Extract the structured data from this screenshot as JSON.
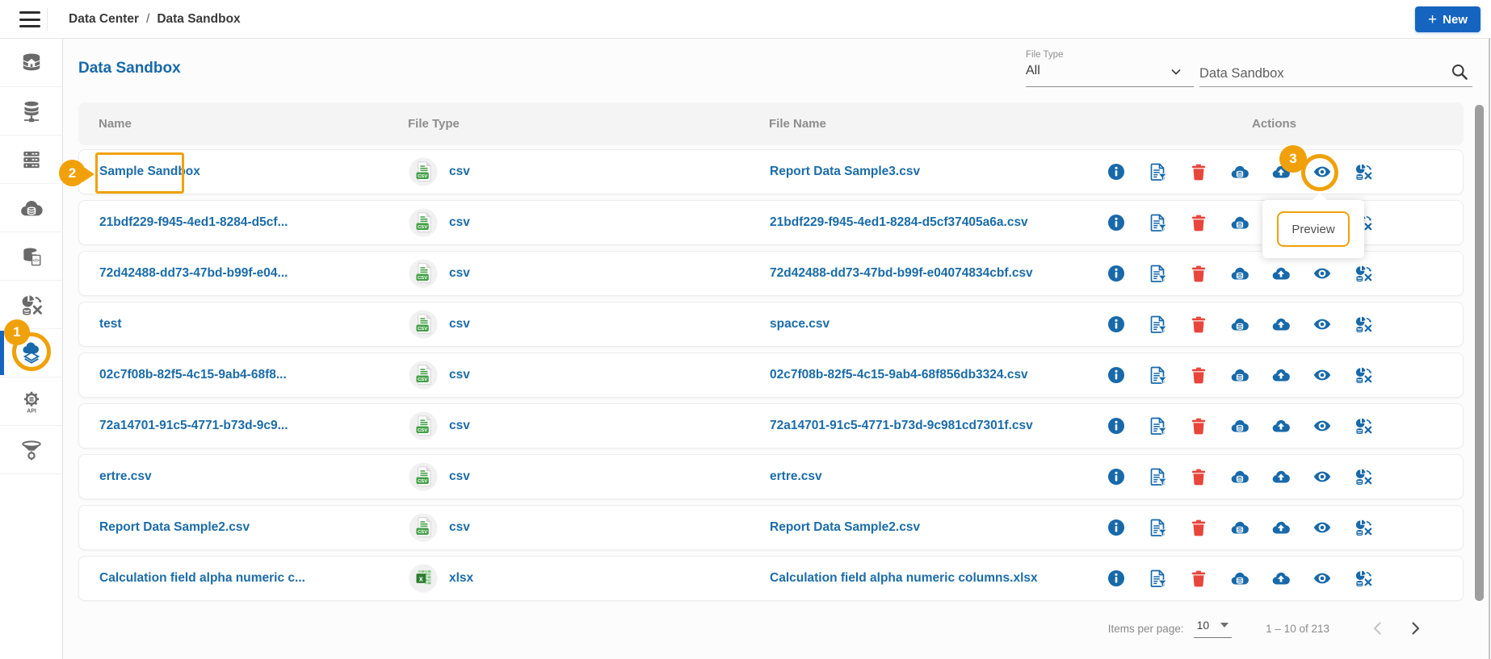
{
  "topbar": {
    "breadcrumb": {
      "items": [
        "Data Center",
        "Data Sandbox"
      ],
      "separator": "/"
    },
    "new_button": {
      "plus": "+",
      "label": "New"
    }
  },
  "sidebar": {
    "items": [
      {
        "icon": "database-home"
      },
      {
        "icon": "database-network"
      },
      {
        "icon": "server-rack"
      },
      {
        "icon": "cloud-data"
      },
      {
        "icon": "cloud-code"
      },
      {
        "icon": "transform"
      },
      {
        "icon": "data-sandbox",
        "active": true
      },
      {
        "icon": "api-gear"
      },
      {
        "icon": "funnel-gear"
      }
    ]
  },
  "page": {
    "title": "Data Sandbox"
  },
  "filters": {
    "file_type": {
      "label": "File Type",
      "value": "All"
    },
    "search": {
      "value": "Data Sandbox"
    }
  },
  "table": {
    "columns": [
      "Name",
      "File Type",
      "File Name",
      "Actions"
    ],
    "actions": [
      "info",
      "doc-filter",
      "delete",
      "cloud-data",
      "cloud-upload",
      "preview",
      "transform"
    ],
    "rows": [
      {
        "name": "Sample Sandbox",
        "file_type": "csv",
        "file_name": "Report Data Sample3.csv"
      },
      {
        "name": "21bdf229-f945-4ed1-8284-d5cf...",
        "file_type": "csv",
        "file_name": "21bdf229-f945-4ed1-8284-d5cf37405a6a.csv"
      },
      {
        "name": "72d42488-dd73-47bd-b99f-e04...",
        "file_type": "csv",
        "file_name": "72d42488-dd73-47bd-b99f-e04074834cbf.csv"
      },
      {
        "name": "test",
        "file_type": "csv",
        "file_name": "space.csv"
      },
      {
        "name": "02c7f08b-82f5-4c15-9ab4-68f8...",
        "file_type": "csv",
        "file_name": "02c7f08b-82f5-4c15-9ab4-68f856db3324.csv"
      },
      {
        "name": "72a14701-91c5-4771-b73d-9c9...",
        "file_type": "csv",
        "file_name": "72a14701-91c5-4771-b73d-9c981cd7301f.csv"
      },
      {
        "name": "ertre.csv",
        "file_type": "csv",
        "file_name": "ertre.csv"
      },
      {
        "name": "Report Data Sample2.csv",
        "file_type": "csv",
        "file_name": "Report Data Sample2.csv"
      },
      {
        "name": "Calculation field alpha numeric c...",
        "file_type": "xlsx",
        "file_name": "Calculation field alpha numeric columns.xlsx"
      }
    ],
    "file_badges": {
      "csv": "CSV",
      "xlsx": "x"
    }
  },
  "annotations": {
    "step1": "1",
    "step2": "2",
    "step3": "3",
    "tooltip": "Preview"
  },
  "pagination": {
    "items_per_page_label": "Items per page:",
    "items_per_page_value": "10",
    "range": "1 – 10 of 213"
  },
  "icons_text": {
    "api": "API",
    "code": "</>"
  },
  "colors": {
    "primary_blue": "#1769aa",
    "button_blue": "#1565c0",
    "link_blue": "#1b6ca8",
    "csv_green": "#43a047",
    "xlsx_green": "#2e7d32",
    "delete_red": "#e8453b",
    "annotation_orange": "#f0a10a",
    "header_gray": "#8d8d8d"
  }
}
